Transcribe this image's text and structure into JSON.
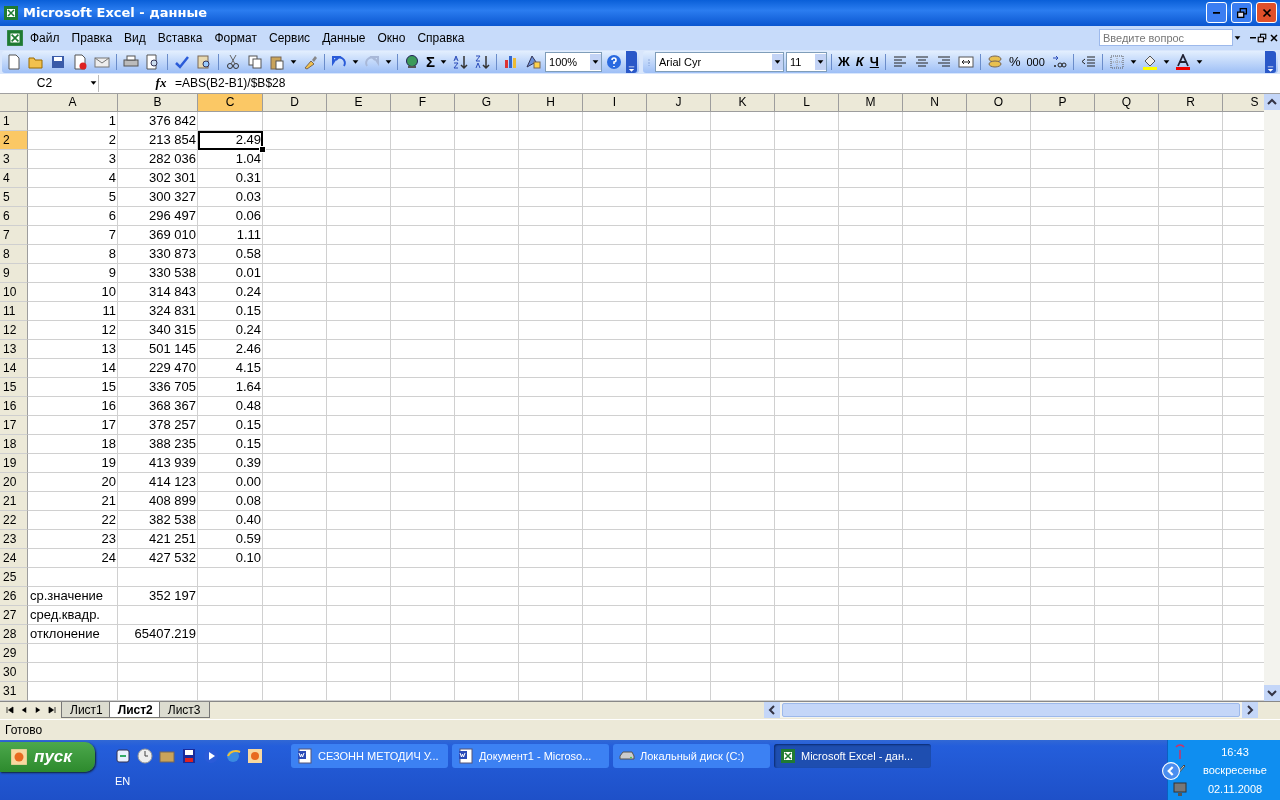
{
  "window": {
    "title": "Microsoft Excel - данные"
  },
  "menu": [
    "Файл",
    "Правка",
    "Вид",
    "Вставка",
    "Формат",
    "Сервис",
    "Данные",
    "Окно",
    "Справка"
  ],
  "help_box": {
    "placeholder": "Введите вопрос"
  },
  "standard_toolbar": {
    "sum": "Σ",
    "zoom": "100%"
  },
  "format_toolbar": {
    "font": "Arial Cyr",
    "size": "11",
    "bold": "Ж",
    "italic": "К",
    "underline": "Ч",
    "percent": "%",
    "thousands": "000"
  },
  "formula_bar": {
    "name_box": "C2",
    "function_button": "fx",
    "formula": "=ABS(B2-B1)/$B$28"
  },
  "grid": {
    "columns": [
      {
        "label": "A",
        "selected": false
      },
      {
        "label": "B",
        "selected": false
      },
      {
        "label": "C",
        "selected": true
      },
      {
        "label": "D",
        "selected": false
      },
      {
        "label": "E",
        "selected": false
      },
      {
        "label": "F",
        "selected": false
      },
      {
        "label": "G",
        "selected": false
      },
      {
        "label": "H",
        "selected": false
      },
      {
        "label": "I",
        "selected": false
      },
      {
        "label": "J",
        "selected": false
      },
      {
        "label": "K",
        "selected": false
      },
      {
        "label": "L",
        "selected": false
      },
      {
        "label": "M",
        "selected": false
      },
      {
        "label": "N",
        "selected": false
      },
      {
        "label": "O",
        "selected": false
      },
      {
        "label": "P",
        "selected": false
      },
      {
        "label": "Q",
        "selected": false
      },
      {
        "label": "R",
        "selected": false
      },
      {
        "label": "S",
        "selected": false
      }
    ],
    "rows": [
      {
        "label": "1",
        "selected": false,
        "cells": [
          {
            "text": "1",
            "kind": "number"
          },
          {
            "text": "376 842",
            "kind": "number"
          }
        ]
      },
      {
        "label": "2",
        "selected": true,
        "cells": [
          {
            "text": "2",
            "kind": "number"
          },
          {
            "text": "213 854",
            "kind": "number"
          },
          {
            "text": "2.49",
            "kind": "number"
          }
        ]
      },
      {
        "label": "3",
        "selected": false,
        "cells": [
          {
            "text": "3",
            "kind": "number"
          },
          {
            "text": "282 036",
            "kind": "number"
          },
          {
            "text": "1.04",
            "kind": "number"
          }
        ]
      },
      {
        "label": "4",
        "selected": false,
        "cells": [
          {
            "text": "4",
            "kind": "number"
          },
          {
            "text": "302 301",
            "kind": "number"
          },
          {
            "text": "0.31",
            "kind": "number"
          }
        ]
      },
      {
        "label": "5",
        "selected": false,
        "cells": [
          {
            "text": "5",
            "kind": "number"
          },
          {
            "text": "300 327",
            "kind": "number"
          },
          {
            "text": "0.03",
            "kind": "number"
          }
        ]
      },
      {
        "label": "6",
        "selected": false,
        "cells": [
          {
            "text": "6",
            "kind": "number"
          },
          {
            "text": "296 497",
            "kind": "number"
          },
          {
            "text": "0.06",
            "kind": "number"
          }
        ]
      },
      {
        "label": "7",
        "selected": false,
        "cells": [
          {
            "text": "7",
            "kind": "number"
          },
          {
            "text": "369 010",
            "kind": "number"
          },
          {
            "text": "1.11",
            "kind": "number"
          }
        ]
      },
      {
        "label": "8",
        "selected": false,
        "cells": [
          {
            "text": "8",
            "kind": "number"
          },
          {
            "text": "330 873",
            "kind": "number"
          },
          {
            "text": "0.58",
            "kind": "number"
          }
        ]
      },
      {
        "label": "9",
        "selected": false,
        "cells": [
          {
            "text": "9",
            "kind": "number"
          },
          {
            "text": "330 538",
            "kind": "number"
          },
          {
            "text": "0.01",
            "kind": "number"
          }
        ]
      },
      {
        "label": "10",
        "selected": false,
        "cells": [
          {
            "text": "10",
            "kind": "number"
          },
          {
            "text": "314 843",
            "kind": "number"
          },
          {
            "text": "0.24",
            "kind": "number"
          }
        ]
      },
      {
        "label": "11",
        "selected": false,
        "cells": [
          {
            "text": "11",
            "kind": "number"
          },
          {
            "text": "324 831",
            "kind": "number"
          },
          {
            "text": "0.15",
            "kind": "number"
          }
        ]
      },
      {
        "label": "12",
        "selected": false,
        "cells": [
          {
            "text": "12",
            "kind": "number"
          },
          {
            "text": "340 315",
            "kind": "number"
          },
          {
            "text": "0.24",
            "kind": "number"
          }
        ]
      },
      {
        "label": "13",
        "selected": false,
        "cells": [
          {
            "text": "13",
            "kind": "number"
          },
          {
            "text": "501 145",
            "kind": "number"
          },
          {
            "text": "2.46",
            "kind": "number"
          }
        ]
      },
      {
        "label": "14",
        "selected": false,
        "cells": [
          {
            "text": "14",
            "kind": "number"
          },
          {
            "text": "229 470",
            "kind": "number"
          },
          {
            "text": "4.15",
            "kind": "number"
          }
        ]
      },
      {
        "label": "15",
        "selected": false,
        "cells": [
          {
            "text": "15",
            "kind": "number"
          },
          {
            "text": "336 705",
            "kind": "number"
          },
          {
            "text": "1.64",
            "kind": "number"
          }
        ]
      },
      {
        "label": "16",
        "selected": false,
        "cells": [
          {
            "text": "16",
            "kind": "number"
          },
          {
            "text": "368 367",
            "kind": "number"
          },
          {
            "text": "0.48",
            "kind": "number"
          }
        ]
      },
      {
        "label": "17",
        "selected": false,
        "cells": [
          {
            "text": "17",
            "kind": "number"
          },
          {
            "text": "378 257",
            "kind": "number"
          },
          {
            "text": "0.15",
            "kind": "number"
          }
        ]
      },
      {
        "label": "18",
        "selected": false,
        "cells": [
          {
            "text": "18",
            "kind": "number"
          },
          {
            "text": "388 235",
            "kind": "number"
          },
          {
            "text": "0.15",
            "kind": "number"
          }
        ]
      },
      {
        "label": "19",
        "selected": false,
        "cells": [
          {
            "text": "19",
            "kind": "number"
          },
          {
            "text": "413 939",
            "kind": "number"
          },
          {
            "text": "0.39",
            "kind": "number"
          }
        ]
      },
      {
        "label": "20",
        "selected": false,
        "cells": [
          {
            "text": "20",
            "kind": "number"
          },
          {
            "text": "414 123",
            "kind": "number"
          },
          {
            "text": "0.00",
            "kind": "number"
          }
        ]
      },
      {
        "label": "21",
        "selected": false,
        "cells": [
          {
            "text": "21",
            "kind": "number"
          },
          {
            "text": "408 899",
            "kind": "number"
          },
          {
            "text": "0.08",
            "kind": "number"
          }
        ]
      },
      {
        "label": "22",
        "selected": false,
        "cells": [
          {
            "text": "22",
            "kind": "number"
          },
          {
            "text": "382 538",
            "kind": "number"
          },
          {
            "text": "0.40",
            "kind": "number"
          }
        ]
      },
      {
        "label": "23",
        "selected": false,
        "cells": [
          {
            "text": "23",
            "kind": "number"
          },
          {
            "text": "421 251",
            "kind": "number"
          },
          {
            "text": "0.59",
            "kind": "number"
          }
        ]
      },
      {
        "label": "24",
        "selected": false,
        "cells": [
          {
            "text": "24",
            "kind": "number"
          },
          {
            "text": "427 532",
            "kind": "number"
          },
          {
            "text": "0.10",
            "kind": "number"
          }
        ]
      },
      {
        "label": "25",
        "selected": false
      },
      {
        "label": "26",
        "selected": false,
        "cells": [
          {
            "text": "ср.значение",
            "kind": "text"
          },
          {
            "text": "352 197",
            "kind": "number"
          }
        ]
      },
      {
        "label": "27",
        "selected": false,
        "cells": [
          {
            "text": "сред.квадр.",
            "kind": "text"
          }
        ]
      },
      {
        "label": "28",
        "selected": false,
        "cells": [
          {
            "text": "отклонение",
            "kind": "text"
          },
          {
            "text": "65407.219",
            "kind": "number"
          }
        ]
      },
      {
        "label": "29",
        "selected": false
      },
      {
        "label": "30",
        "selected": false
      },
      {
        "label": "31",
        "selected": false
      }
    ]
  },
  "sheet_tabs": [
    {
      "label": "Лист1",
      "selected": false
    },
    {
      "label": "Лист2",
      "selected": true
    },
    {
      "label": "Лист3",
      "selected": false
    }
  ],
  "status_bar": {
    "text": "Готово"
  },
  "taskbar": {
    "start": "пуск",
    "language": "EN",
    "tasks": [
      {
        "label": "СЕЗОНН МЕТОДИЧ У...",
        "kind": "word",
        "selected": false
      },
      {
        "label": "Документ1 - Microso...",
        "kind": "word",
        "selected": false
      },
      {
        "label": "Локальный диск (C:)",
        "kind": "drive",
        "selected": false
      },
      {
        "label": "Microsoft Excel - дан...",
        "kind": "excel",
        "selected": true
      }
    ],
    "clock": {
      "time": "16:43",
      "day": "воскресенье",
      "date": "02.11.2008"
    }
  }
}
